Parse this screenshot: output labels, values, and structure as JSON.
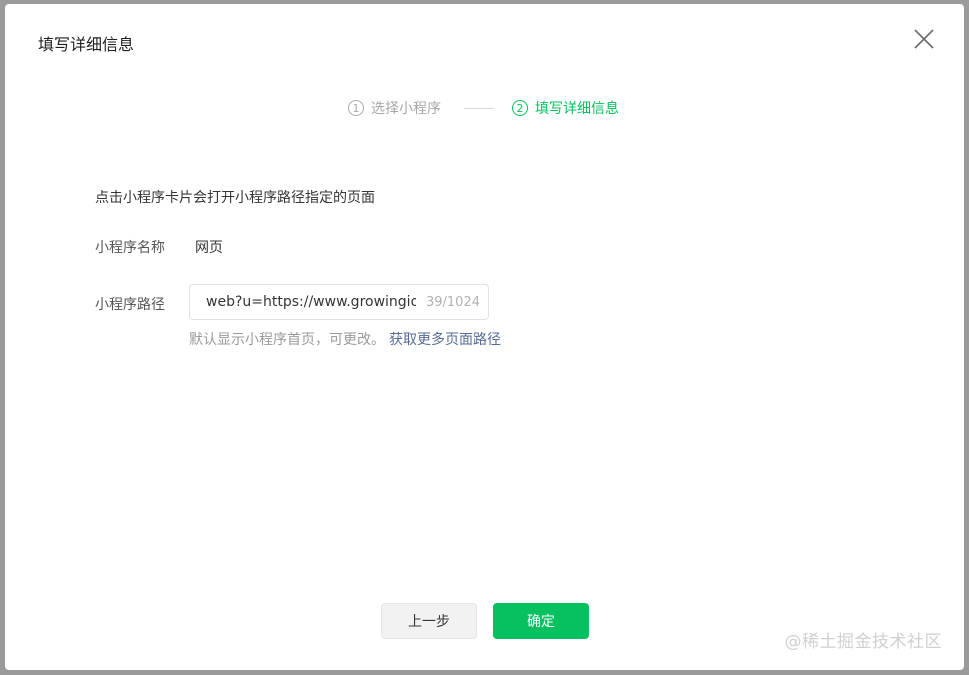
{
  "dialog": {
    "title": "填写详细信息",
    "close_icon": "close-icon"
  },
  "steps": [
    {
      "number": "1",
      "label": "选择小程序",
      "state": "done",
      "color": "#a8a8a8"
    },
    {
      "number": "2",
      "label": "填写详细信息",
      "state": "active",
      "color": "#07c160"
    }
  ],
  "form": {
    "description": "点击小程序卡片会打开小程序路径指定的页面",
    "name_label": "小程序名称",
    "name_value": "网页",
    "path_label": "小程序路径",
    "path_value": "web?u=https://www.growingio.",
    "path_counter": "39/1024",
    "hint_text": "默认显示小程序首页，可更改。",
    "hint_link": "获取更多页面路径",
    "link_color": "#576b95"
  },
  "buttons": {
    "prev_label": "上一步",
    "ok_label": "确定",
    "accent": "#07c160"
  },
  "watermark": "@稀土掘金技术社区"
}
